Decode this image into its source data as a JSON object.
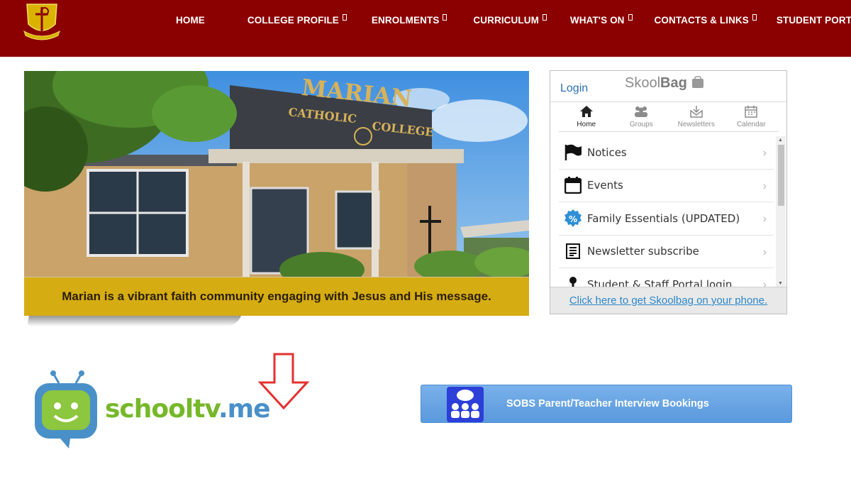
{
  "colors": {
    "brand": "#8b0000",
    "caption_bg": "#d6a800",
    "link": "#2c87c9",
    "sobs_button": "#5a99dd"
  },
  "header": {
    "logo_icon": "college-crest-icon",
    "nav": [
      {
        "label": "HOME",
        "has_dropdown": false
      },
      {
        "label": "COLLEGE PROFILE",
        "has_dropdown": true
      },
      {
        "label": "ENROLMENTS",
        "has_dropdown": true
      },
      {
        "label": "CURRICULUM",
        "has_dropdown": true
      },
      {
        "label": "WHAT'S ON",
        "has_dropdown": true
      },
      {
        "label": "CONTACTS & LINKS",
        "has_dropdown": true
      },
      {
        "label": "STUDENT PORTAL",
        "has_dropdown": false
      }
    ]
  },
  "hero": {
    "sign_line1": "MARIAN",
    "sign_line2": "CATHOLIC",
    "sign_line3": "COLLEGE",
    "caption": "Marian is a vibrant faith community engaging with Jesus and His message."
  },
  "skoolbag": {
    "login": "Login",
    "logo_text_a": "Skool",
    "logo_text_b": "Bag",
    "tabs": [
      {
        "label": "Home",
        "icon": "home-icon",
        "active": true
      },
      {
        "label": "Groups",
        "icon": "groups-icon",
        "active": false
      },
      {
        "label": "Newsletters",
        "icon": "newsletters-icon",
        "active": false
      },
      {
        "label": "Calendar",
        "icon": "calendar-icon",
        "active": false
      }
    ],
    "items": [
      {
        "label": "Notices",
        "icon": "flag-icon"
      },
      {
        "label": "Events",
        "icon": "calendar-icon"
      },
      {
        "label": "Family Essentials (UPDATED)",
        "icon": "percent-badge-icon"
      },
      {
        "label": "Newsletter subscribe",
        "icon": "newsletter-icon"
      },
      {
        "label": "Student & Staff Portal login",
        "icon": "key-icon"
      }
    ],
    "footer_link": "Click here to get Skoolbag on your phone."
  },
  "schooltv": {
    "text_a": "schooltv",
    "text_b": ".me"
  },
  "sobs": {
    "label": "SOBS Parent/Teacher Interview Bookings",
    "icon": "people-meeting-icon"
  }
}
